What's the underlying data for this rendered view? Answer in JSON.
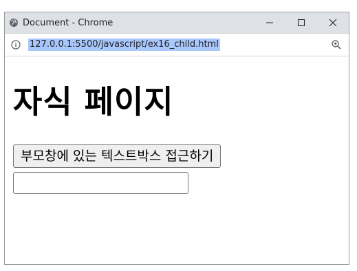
{
  "window": {
    "title": "Document - Chrome",
    "globe_icon": "globe-icon",
    "controls": [
      "minimize-icon",
      "maximize-icon",
      "close-icon"
    ]
  },
  "address": {
    "url": "127.0.0.1:5500/javascript/ex16_child.html",
    "info_icon": "info-icon",
    "zoom_icon": "zoom-icon",
    "url_highlight_color": "#a8c7fa"
  },
  "page": {
    "heading": "자식 페이지",
    "access_button_label": "부모창에 있는 텍스트박스 접근하기",
    "textbox_value": ""
  }
}
